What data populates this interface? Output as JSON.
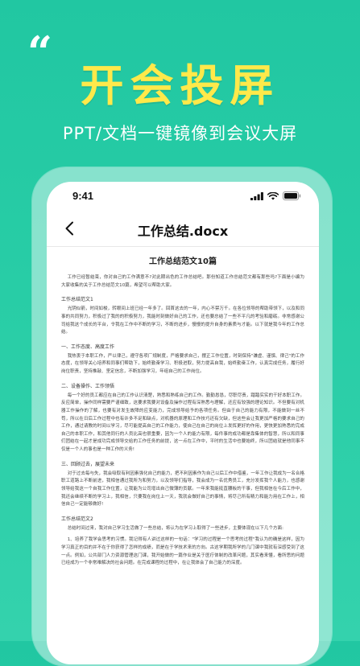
{
  "headline": "开会投屏",
  "subheadline": "PPT/文档一键镜像到会议大屏",
  "phone": {
    "status_time": "9:41",
    "nav_title": "工作总结.docx",
    "document": {
      "title": "工作总结范文10篇",
      "blocks": [
        {
          "type": "p",
          "text": "工作已经暂结束，你对自己的工作满意不?对此期出色的工作总结吧。那份知道工作总结范文都有那些吗?下面是小编为大家收集的关于工作总结范文10篇，希望可以帮助大家。"
        },
        {
          "type": "h",
          "text": "工作总结范文1"
        },
        {
          "type": "p",
          "text": "光阴似箭，时间如梭，转眼间上班已经一年多了。回首这去的一年，内心不禁万千。在各位领导的帮助带领下，以及和同事的共同努力，积极过了我的的积极努力，我能时刻做好自己的工作，还也要总结了一些不平凡的考验和磨砺。非常感谢公司给我这个成长的平台，令我在工作中不断的学习，不断的进步，慢慢的提升自身的素质与才能。以下就是我今年的工作总结。"
        },
        {
          "type": "h",
          "text": "一、工作态度、高度工作"
        },
        {
          "type": "p",
          "text": "我热衷于本职工作，严以律己，遵守各项厂规制度，严格要求自己，摆正工作位置，时刻保持\"谦虚、谨慎、律己\"的工作态度，在领导关心培养和同事们帮助下，始终勤奋学习、积极进取，努力提高自我，始终勤奋工作，认真完成任务，履行好岗位职责，坚持推敲、坚定信念，不断加强学习，年组自己的工作岗位。"
        },
        {
          "type": "h",
          "text": "二、设备操作、工作领悟"
        },
        {
          "type": "p",
          "text": "每一个好的员工都应在自己的工作认识清楚，熟悉和熟练自己的工作。勤勤恳恳，尽职尽责，踏踏实实的干好本职工作。反应简单，操作同样需要严谨细致，这要求我要对设备及操作过程有深熟悉与理解，还应有较强的理论知识。不但要有对机器工作操作的了解，也要有对发生故障的应变能力，完成领导给予的各项任务。但由于自己的能力有限，不能做到一丝不苟，所以在日后工作过程中也有许多不足和缺点，对机器的原理和工作技巧还有欠缺，但这些会让我更加严格的要求自己的工作，通过请教的时间以学习，尽可能提高自己的工作能力，使自己在自己的岗位上发挥更好的作用，更快更加熟悉的完成自己的本职工作，和其他同行的人员比高也很重要，因为一个人的能力有限，每件事的成功都是靠集体的智慧，所以和同事们团结在一起才是成功完成领导交给的工作任务的前提，这一点在工作中，平时的生活中也要始终，所以团结就是他同事不仅是一个人的事也是一种工作的义务!"
        },
        {
          "type": "h",
          "text": "三、回顾过去，展望未来"
        },
        {
          "type": "p",
          "text": "对于过去每与失，我会吸取有利因素强化自己的能力，把不利因素作为自己以后工作中借鉴，一年工作让我成为一名合格职工道路上不断前进，我相信通过我所为和努力，以及领导们指导，我会成为一名优秀员工，充分发挥我个人能力，也感谢领导给我这一个自我工作位置，让我能为公司增出自己微薄的贡献。一年来我能挺直腰板的干事，但我相信在今后工作中，我还会继续不断的学习上，我相信，只要我在岗位上一天，我就会做好自己的事情，将尽己所有精力和能力用在工作上，相信自己一定能够做好!"
        },
        {
          "type": "h",
          "text": "工作总结范文2"
        },
        {
          "type": "p",
          "text": "总结时间过来，我对自己学习生活做了一些总结，将认为在学习上取得了一些进步，主要体现在以下几个方面:"
        },
        {
          "type": "p",
          "text": "1、培养了我学会思考的习惯。我记得有人讲过这样的一句话：\"学习的过程是一个思考的过程\"我认为的确是这样，因为学习真正的目的并不在于你获得了怎样的成绩，而是在于学技术来的方向。古这学期我所学的几门课中我就有深感受到了这一点。例如，公共部门人力资源管理这门课，我开始做的一篇作业是关于医疗体制的改革问题，其实看来懂，看所思的问题已经成为一个非常难解决的社会问题。在完成课程的过程中，在让我体会了自己能力的深度。"
        }
      ]
    }
  },
  "icons": {
    "quote": "quote-mark-icon",
    "back": "chevron-left-icon",
    "signal": "signal-icon",
    "wifi": "wifi-icon",
    "battery": "battery-icon"
  },
  "colors": {
    "background_top": "#21c7a2",
    "background_bottom": "#34d2ad",
    "headline": "#ffe94a",
    "subheadline": "#ffffff",
    "screen": "#ffffff"
  }
}
